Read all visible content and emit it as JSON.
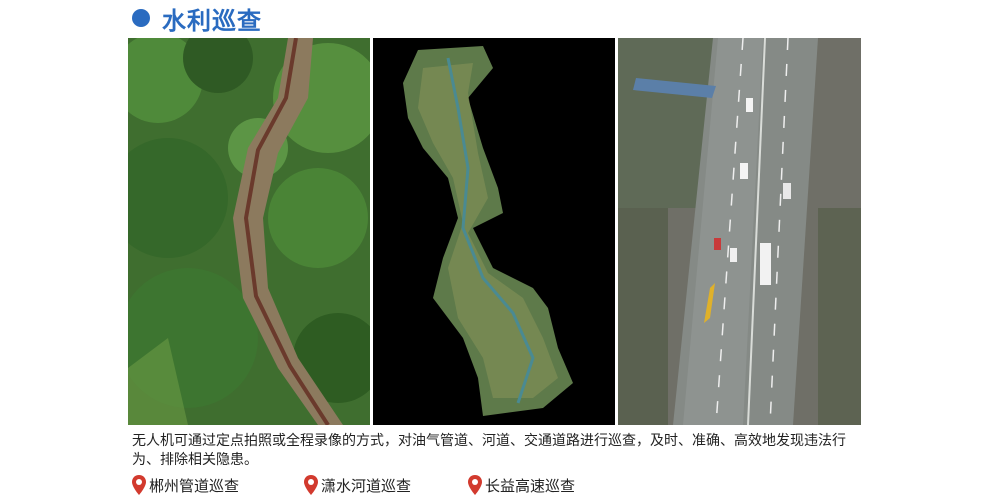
{
  "section": {
    "title": "水利巡查",
    "accent_color": "#2a6bc0"
  },
  "photos": [
    {
      "subject": "forest-pipeline-aerial"
    },
    {
      "subject": "river-orthomosaic"
    },
    {
      "subject": "highway-aerial"
    }
  ],
  "description": "无人机可通过定点拍照或全程录像的方式，对油气管道、河道、交通道路进行巡查，及时、准确、高效地发现违法行为、排除相关隐患。",
  "captions": [
    {
      "label": "郴州管道巡查",
      "icon": "location-pin-icon"
    },
    {
      "label": "潇水河道巡查",
      "icon": "location-pin-icon"
    },
    {
      "label": "长益高速巡查",
      "icon": "location-pin-icon"
    }
  ],
  "pin_color": "#d23a2e"
}
